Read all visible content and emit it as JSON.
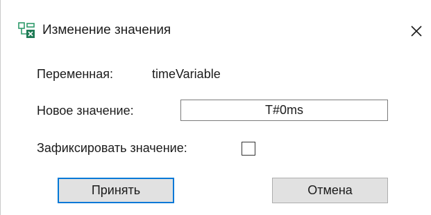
{
  "window": {
    "title": "Изменение значения",
    "icon": "variable-window-icon",
    "close_icon": "close-icon"
  },
  "form": {
    "variable_label": "Переменная:",
    "variable_name": "timeVariable",
    "new_value_label": "Новое значение:",
    "new_value": "T#0ms",
    "fix_label": "Зафиксировать значение:",
    "fix_checked": false
  },
  "buttons": {
    "accept_label": "Принять",
    "cancel_label": "Отмена"
  },
  "colors": {
    "accent": "#0078d7",
    "button_bg": "#e1e1e1",
    "icon_green": "#2e9a6a"
  }
}
